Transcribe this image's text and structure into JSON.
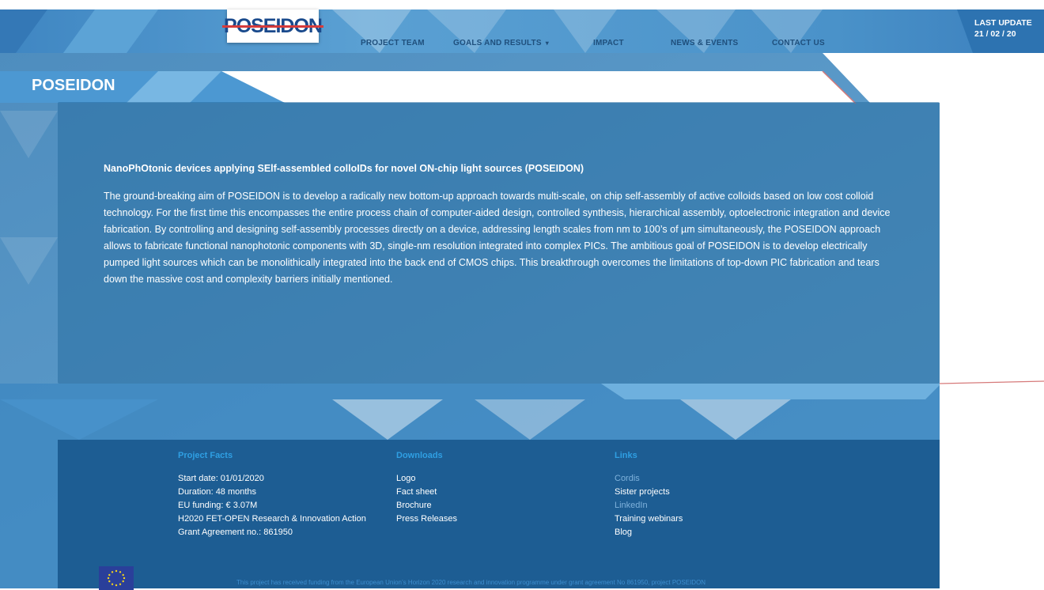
{
  "header": {
    "logo_text": "POSEIDON",
    "nav": [
      {
        "label": "PROJECT TEAM"
      },
      {
        "label": "GOALS AND RESULTS"
      },
      {
        "label": "IMPACT"
      },
      {
        "label": "NEWS & EVENTS"
      },
      {
        "label": "CONTACT US"
      }
    ],
    "goals_caret": "▾",
    "last_update_label": "LAST UPDATE",
    "last_update_date": "21 / 02 / 20"
  },
  "page": {
    "title": "POSEIDON"
  },
  "main": {
    "heading": "NanoPhOtonic devices applying SElf-assembled colloIDs for novel ON-chip light sources (POSEIDON)",
    "body": "The ground-breaking aim of POSEIDON is to develop a radically new bottom-up approach towards multi-scale, on chip self-assembly of active colloids based on low cost colloid technology. For the first time this encompasses the entire process chain of computer-aided design, controlled synthesis, hierarchical assembly, optoelectronic integration and device fabrication. By controlling and designing self-assembly processes directly on a device, addressing length scales from nm to 100’s of µm simultaneously, the POSEIDON approach allows to fabricate functional nanophotonic components with 3D, single-nm resolution integrated into complex PICs. The ambitious goal of POSEIDON is to develop electrically pumped light sources which can be monolithically integrated into the back end of CMOS chips. This breakthrough overcomes the limitations of top-down PIC fabrication and tears down the massive cost and complexity barriers initially mentioned."
  },
  "footer": {
    "project_facts": {
      "title": "Project Facts",
      "items": [
        "Start date: 01/01/2020",
        "Duration: 48 months",
        "EU funding: € 3.07M",
        "H2020 FET-OPEN Research & Innovation Action",
        "Grant Agreement no.: 861950"
      ]
    },
    "downloads": {
      "title": "Downloads",
      "items": [
        "Logo",
        "Fact sheet",
        "Brochure",
        "Press Releases"
      ]
    },
    "links": {
      "title": "Links",
      "items": [
        "Cordis",
        "Sister projects",
        "LinkedIn",
        "Training webinars",
        "Blog"
      ]
    },
    "eu_flag_icon": "eu-flag-icon",
    "funding_note": "This project has received funding from the European Union’s Horizon 2020 research and innovation programme under grant agreement No 861950, project POSEIDON"
  },
  "colors": {
    "nav_text": "#1f4f7c",
    "panel": "#286ea0",
    "footer": "#1d5d93",
    "footer_heading": "#2f9fe3",
    "accent_red": "#d63b3b"
  }
}
